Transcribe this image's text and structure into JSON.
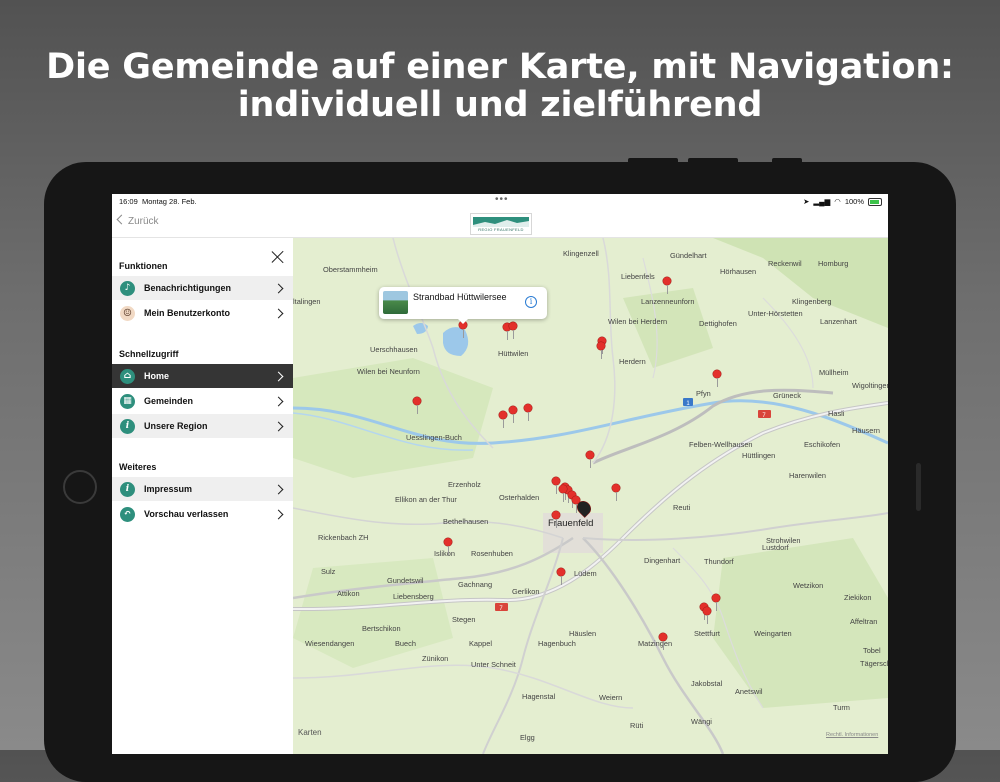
{
  "headline": {
    "line1": "Die Gemeinde auf einer Karte, mit Navigation:",
    "line2": "individuell und zielführend"
  },
  "status_bar": {
    "time": "16:09",
    "date": "Montag 28. Feb.",
    "battery": "100%"
  },
  "nav": {
    "back_label": "Zurück",
    "logo_text": "REGIO FRAUENFELD"
  },
  "sidebar": {
    "sections": [
      {
        "title": "Funktionen",
        "items": [
          {
            "label": "Benachrichtigungen",
            "icon": "bell-icon",
            "glyph": "🔔"
          },
          {
            "label": "Mein Benutzerkonto",
            "icon": "user-avatar-icon",
            "glyph": "☺"
          }
        ]
      },
      {
        "title": "Schnellzugriff",
        "items": [
          {
            "label": "Home",
            "icon": "home-icon",
            "glyph": "⌂"
          },
          {
            "label": "Gemeinden",
            "icon": "municipality-icon",
            "glyph": "▦"
          },
          {
            "label": "Unsere Region",
            "icon": "info-icon",
            "glyph": "i"
          }
        ]
      },
      {
        "title": "Weiteres",
        "items": [
          {
            "label": "Impressum",
            "icon": "info-icon",
            "glyph": "i"
          },
          {
            "label": "Vorschau verlassen",
            "icon": "return-icon",
            "glyph": "↶"
          }
        ]
      }
    ],
    "active_item": "Home"
  },
  "map": {
    "callout_title": "Strandbad Hüttwilersee",
    "attribution": "Karten",
    "legal": "Rechtl. Informationen",
    "route_shields": [
      "1",
      "7",
      "7"
    ],
    "place_labels": [
      "Oberstammheim",
      "ltalingen",
      "Uerschhausen",
      "Wilen bei Neunforn",
      "Uesslingen-Buch",
      "Hüttwilen",
      "Klingenzell",
      "Gündelhart",
      "Hörhausen",
      "Reckenwil",
      "Homburg",
      "Liebenfels",
      "Lanzenneunforn",
      "Wilen bei Herdern",
      "Dettighofen",
      "Herdern",
      "Unter-Hörstetten",
      "Klingenberg",
      "Lanzenhart",
      "Müllheim",
      "Wigoltingen",
      "Pfyn",
      "Grüneck",
      "Hasli",
      "Häusern",
      "Eschikofen",
      "Felben-Wellhausen",
      "Hüttlingen",
      "Harenwilen",
      "Erzenholz",
      "Osterhalden",
      "Ellikon an der Thur",
      "Bethelhausen",
      "Frauenfeld",
      "Reuti",
      "Rickenbach ZH",
      "Islikon",
      "Rosenhuben",
      "Dingenhart",
      "Thundorf",
      "Strohwilen",
      "Lustdorf",
      "Sulz",
      "Gundetswil",
      "Gachnang",
      "Lüdem",
      "Attikon",
      "Liebensberg",
      "Gerlikon",
      "Wetzikon",
      "Ziekikon",
      "Bertschikon",
      "Stegen",
      "Affeltran",
      "Wiesendangen",
      "Buech",
      "Kappel",
      "Häuslen",
      "Hagenbuch",
      "Matzingen",
      "Stettfurt",
      "Weingarten",
      "Zünikon",
      "Unter Schneit",
      "Tobel",
      "Tägerschen",
      "Hagenstal",
      "Weiern",
      "Jakobstal",
      "Anetswil",
      "Elgg",
      "Wängi",
      "Rüti",
      "Turm"
    ]
  },
  "colors": {
    "accent": "#2e8f7d",
    "active_row": "#353535",
    "pin": "#e3302b"
  }
}
